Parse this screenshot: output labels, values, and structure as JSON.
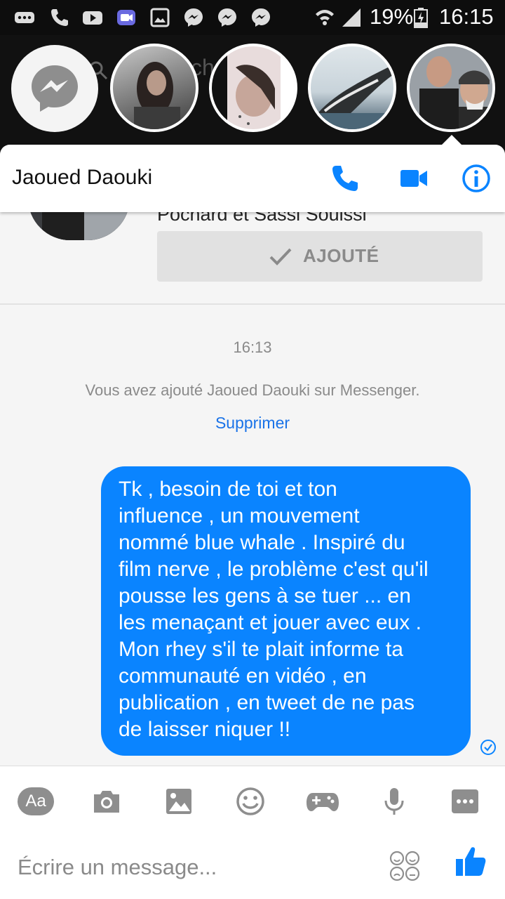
{
  "status_bar": {
    "battery": "19%",
    "time": "16:15"
  },
  "chat_heads": {
    "search_placeholder": "ch"
  },
  "conversation": {
    "contact_name": "Jaoued Daouki",
    "profile": {
      "mutual_text": "Pochard et Sassi Souissi",
      "added_label": "AJOUTÉ"
    },
    "timestamp": "16:13",
    "system_message": "Vous avez ajouté Jaoued Daouki sur Messenger.",
    "remove_link": "Supprimer",
    "messages": [
      {
        "text": "Tk , besoin de toi et ton\ninfluence , un mouvement\nnommé  blue whale . Inspiré du\nfilm nerve , le problème c'est qu'il\npousse les gens à se tuer ... en\nles menaçant et jouer avec eux .\nMon rhey s'il te plait informe ta\ncommunauté en vidéo , en\npublication , en tweet de ne pas\nde laisser niquer !!"
      }
    ]
  },
  "composer": {
    "aa_label": "Aa",
    "placeholder": "Écrire un message..."
  },
  "colors": {
    "accent": "#0a84ff",
    "link": "#1a73e8",
    "muted": "#8a8a8a"
  }
}
